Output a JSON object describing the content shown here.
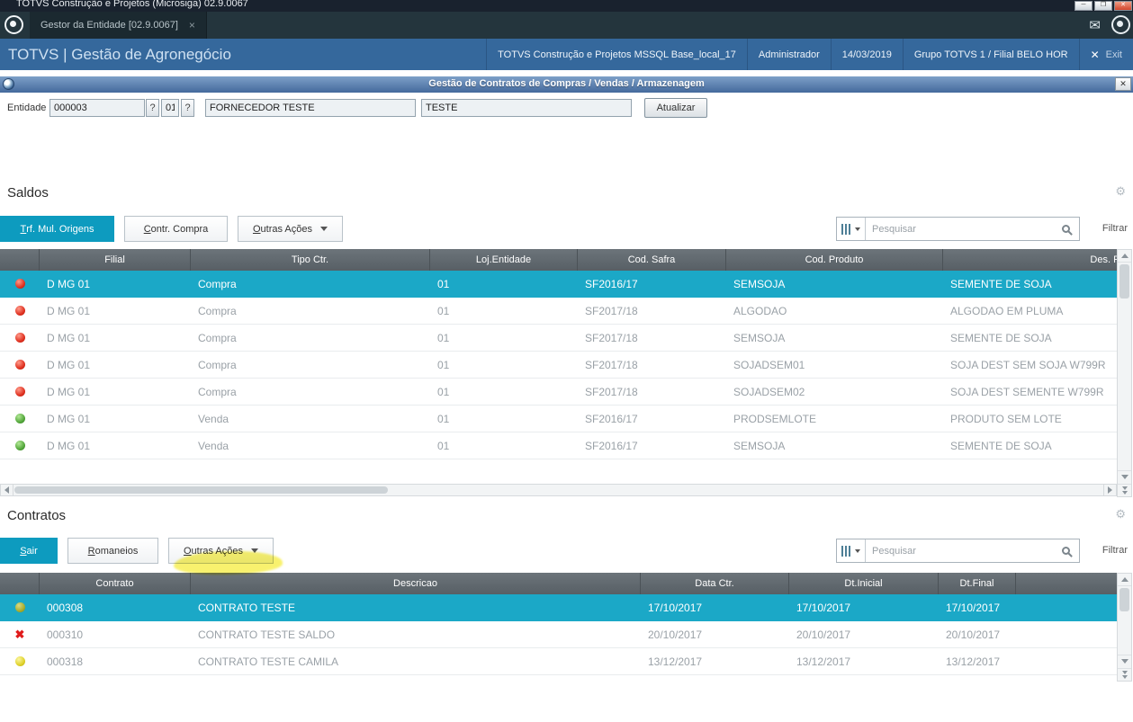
{
  "colors": {
    "accent_teal": "#0d9bbf",
    "selected_row": "#1ba8c7",
    "grid_header_gray": "#5d656b",
    "header_blue": "#35689c",
    "status_red": "#d42020",
    "status_green": "#4aa73c",
    "status_yellow": "#e0d22c",
    "status_olive": "#a9ad2e",
    "error_red": "#e01b1b",
    "annotation_yellow": "#f4e80c"
  },
  "os": {
    "title": "TOTVS Construção e Projetos (Microsiga) 02.9.0067"
  },
  "tabs": {
    "active_tab": "Gestor da Entidade [02.9.0067]"
  },
  "header": {
    "brand": "TOTVS | Gestão de Agronegócio",
    "env": "TOTVS Construção e Projetos MSSQL Base_local_17",
    "user": "Administrador",
    "date": "14/03/2019",
    "branch": "Grupo TOTVS 1 / Filial BELO HOR",
    "exit_label": "Exit"
  },
  "mdi": {
    "title": "Gestão de Contratos de Compras / Vendas / Armazenagem"
  },
  "form": {
    "entity_label": "Entidade",
    "entity_code": "000003",
    "help1": "?",
    "store_code": "01",
    "help2": "?",
    "entity_name": "FORNECEDOR TESTE",
    "entity_short": "TESTE",
    "refresh_button": "Atualizar"
  },
  "saldos": {
    "title": "Saldos",
    "btn_primary_hk": "T",
    "btn_primary_rest": "rf. Mul. Origens",
    "btn2_hk": "C",
    "btn2_rest": "ontr. Compra",
    "btn3_hk": "O",
    "btn3_rest": "utras Ações",
    "search_placeholder": "Pesquisar",
    "filter_label": "Filtrar",
    "columns": [
      "Filial",
      "Tipo Ctr.",
      "Loj.Entidade",
      "Cod. Safra",
      "Cod. Produto",
      "Des. Produto"
    ],
    "rows": [
      {
        "status": "red",
        "filial": "D MG 01",
        "tipo": "Compra",
        "loja": "01",
        "safra": "SF2016/17",
        "produto": "SEMSOJA",
        "descricao": "SEMENTE DE SOJA"
      },
      {
        "status": "red",
        "filial": "D MG 01",
        "tipo": "Compra",
        "loja": "01",
        "safra": "SF2017/18",
        "produto": "ALGODAO",
        "descricao": "ALGODAO EM PLUMA"
      },
      {
        "status": "red",
        "filial": "D MG 01",
        "tipo": "Compra",
        "loja": "01",
        "safra": "SF2017/18",
        "produto": "SEMSOJA",
        "descricao": "SEMENTE DE SOJA"
      },
      {
        "status": "red",
        "filial": "D MG 01",
        "tipo": "Compra",
        "loja": "01",
        "safra": "SF2017/18",
        "produto": "SOJADSEM01",
        "descricao": "SOJA DEST SEM SOJA W799R"
      },
      {
        "status": "red",
        "filial": "D MG 01",
        "tipo": "Compra",
        "loja": "01",
        "safra": "SF2017/18",
        "produto": "SOJADSEM02",
        "descricao": "SOJA DEST SEMENTE W799R"
      },
      {
        "status": "green",
        "filial": "D MG 01",
        "tipo": "Venda",
        "loja": "01",
        "safra": "SF2016/17",
        "produto": "PRODSEMLOTE",
        "descricao": "PRODUTO SEM LOTE"
      },
      {
        "status": "green",
        "filial": "D MG 01",
        "tipo": "Venda",
        "loja": "01",
        "safra": "SF2016/17",
        "produto": "SEMSOJA",
        "descricao": "SEMENTE DE SOJA"
      }
    ],
    "selected_row_index": 0
  },
  "contratos": {
    "title": "Contratos",
    "btn1_hk": "S",
    "btn1_rest": "air",
    "btn2_hk": "R",
    "btn2_rest": "omaneios",
    "btn3_hk": "O",
    "btn3_rest": "utras Ações",
    "search_placeholder": "Pesquisar",
    "filter_label": "Filtrar",
    "columns": [
      "Contrato",
      "Descricao",
      "Data Ctr.",
      "Dt.Inicial",
      "Dt.Final"
    ],
    "rows": [
      {
        "status": "olive",
        "contrato": "000308",
        "descricao": "CONTRATO TESTE",
        "data_ctr": "17/10/2017",
        "dt_inicial": "17/10/2017",
        "dt_final": "17/10/2017"
      },
      {
        "status": "error",
        "contrato": "000310",
        "descricao": "CONTRATO TESTE SALDO",
        "data_ctr": "20/10/2017",
        "dt_inicial": "20/10/2017",
        "dt_final": "20/10/2017"
      },
      {
        "status": "yellow",
        "contrato": "000318",
        "descricao": "CONTRATO TESTE CAMILA",
        "data_ctr": "13/12/2017",
        "dt_inicial": "13/12/2017",
        "dt_final": "13/12/2017"
      }
    ],
    "selected_row_index": 0
  }
}
